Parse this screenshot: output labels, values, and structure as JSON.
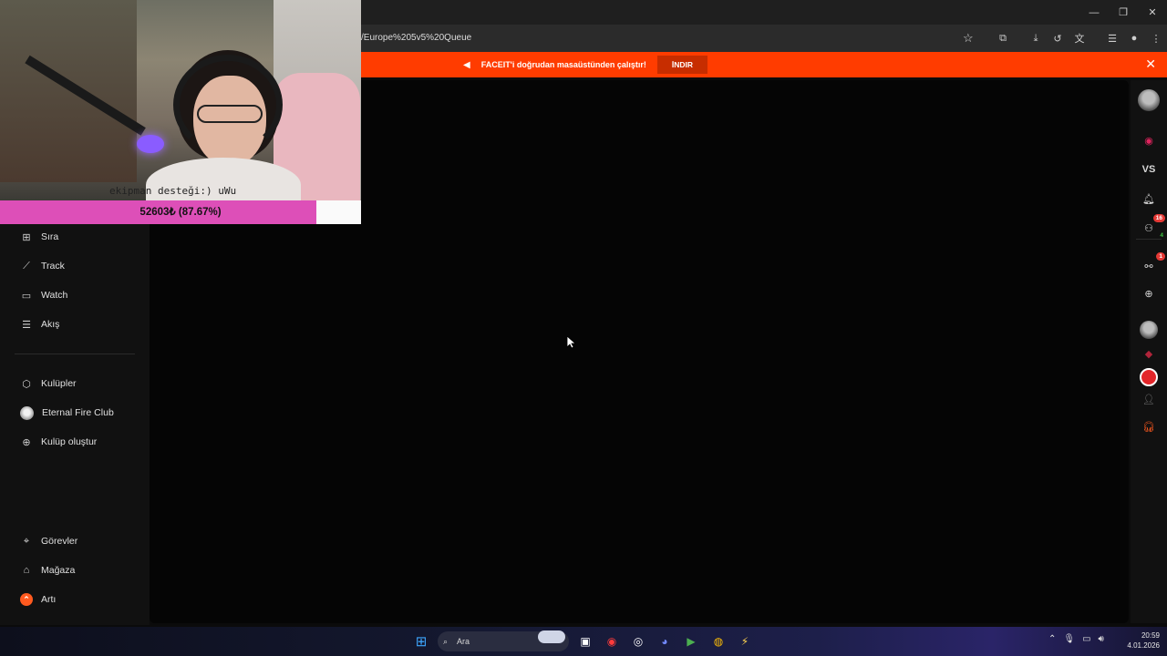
{
  "browser": {
    "url": "/Europe%205v5%20Queue",
    "window_controls": [
      "minimize",
      "restore",
      "close"
    ]
  },
  "banner": {
    "text": "FACEIT'i doğrudan masaüstünden çalıştır!",
    "button_label": "İNDIR"
  },
  "overlay": {
    "caption": "ekipman desteği:) uWu",
    "goal_text": "52603₺ (87.67%)",
    "goal_progress": 0.8767,
    "goal_color": "#dd4fb8"
  },
  "sidebar": {
    "items": [
      {
        "label": "Sıra",
        "icon": "queue-icon"
      },
      {
        "label": "Track",
        "icon": "chart-line-icon"
      },
      {
        "label": "Watch",
        "icon": "video-icon"
      },
      {
        "label": "Akış",
        "icon": "feed-icon"
      }
    ],
    "clubs": [
      {
        "label": "Kulüpler",
        "icon": "clubs-icon"
      },
      {
        "label": "Eternal Fire Club",
        "icon": "club-avatar-icon"
      },
      {
        "label": "Kulüp oluştur",
        "icon": "add-circle-icon"
      }
    ],
    "bottom": [
      {
        "label": "Görevler",
        "icon": "missions-icon"
      },
      {
        "label": "Mağaza",
        "icon": "shop-icon"
      },
      {
        "label": "Artı",
        "icon": "plus-badge-icon"
      }
    ]
  },
  "rail": {
    "vs_label": "VS",
    "friends_badge": "16",
    "friends_online": "4",
    "party_badge": "1"
  },
  "taskbar": {
    "search_label": "Ara",
    "time": "20:59",
    "date": "4.01.2026"
  },
  "colors": {
    "accent": "#ff3c00",
    "background": "#050505"
  }
}
